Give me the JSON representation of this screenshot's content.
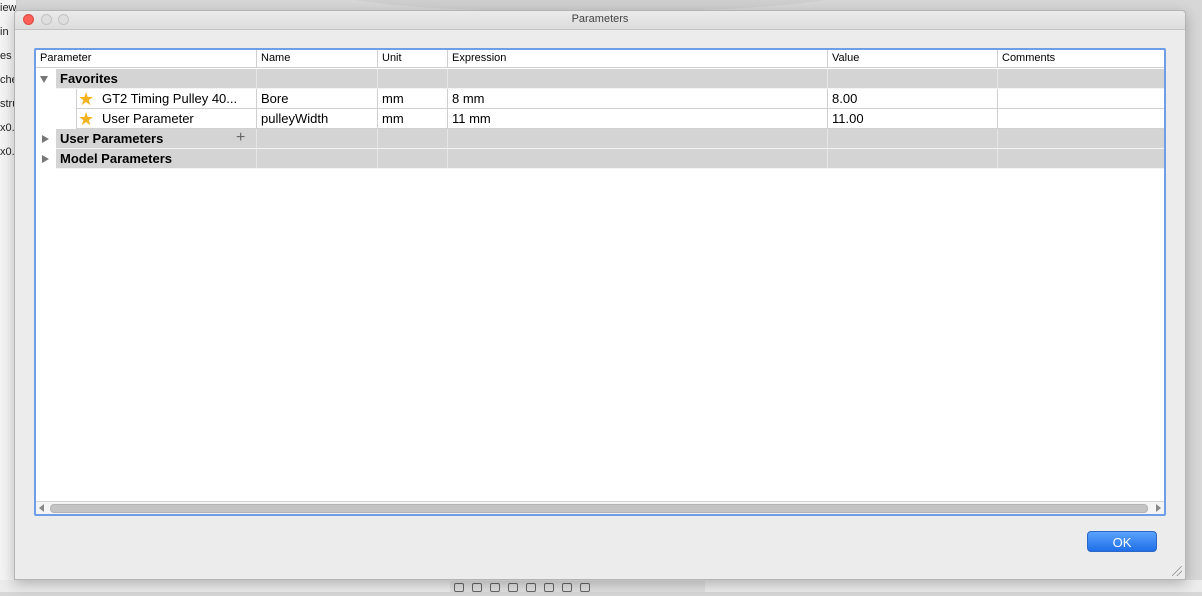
{
  "background": {
    "left_fragments": [
      "iews",
      "in",
      "es",
      "che",
      "stru",
      "x0.",
      "x0."
    ]
  },
  "window": {
    "title": "Parameters"
  },
  "table": {
    "columns": [
      "Parameter",
      "Name",
      "Unit",
      "Expression",
      "Value",
      "Comments"
    ],
    "groups": [
      {
        "label": "Favorites",
        "expanded": true,
        "rows": [
          {
            "parameter": "GT2 Timing Pulley 40...",
            "name": "Bore",
            "unit": "mm",
            "expression": "8 mm",
            "value": "8.00",
            "comments": ""
          },
          {
            "parameter": "User Parameter",
            "name": "pulleyWidth",
            "unit": "mm",
            "expression": "11 mm",
            "value": "11.00",
            "comments": ""
          }
        ]
      },
      {
        "label": "User Parameters",
        "expanded": false
      },
      {
        "label": "Model Parameters",
        "expanded": false
      }
    ]
  },
  "buttons": {
    "ok": "OK"
  },
  "colors": {
    "favorite_star": "#f5b21c",
    "ok_button": "#2a7bf5",
    "focus_ring": "#6e9ee8",
    "close_light": "#fc5f57"
  }
}
